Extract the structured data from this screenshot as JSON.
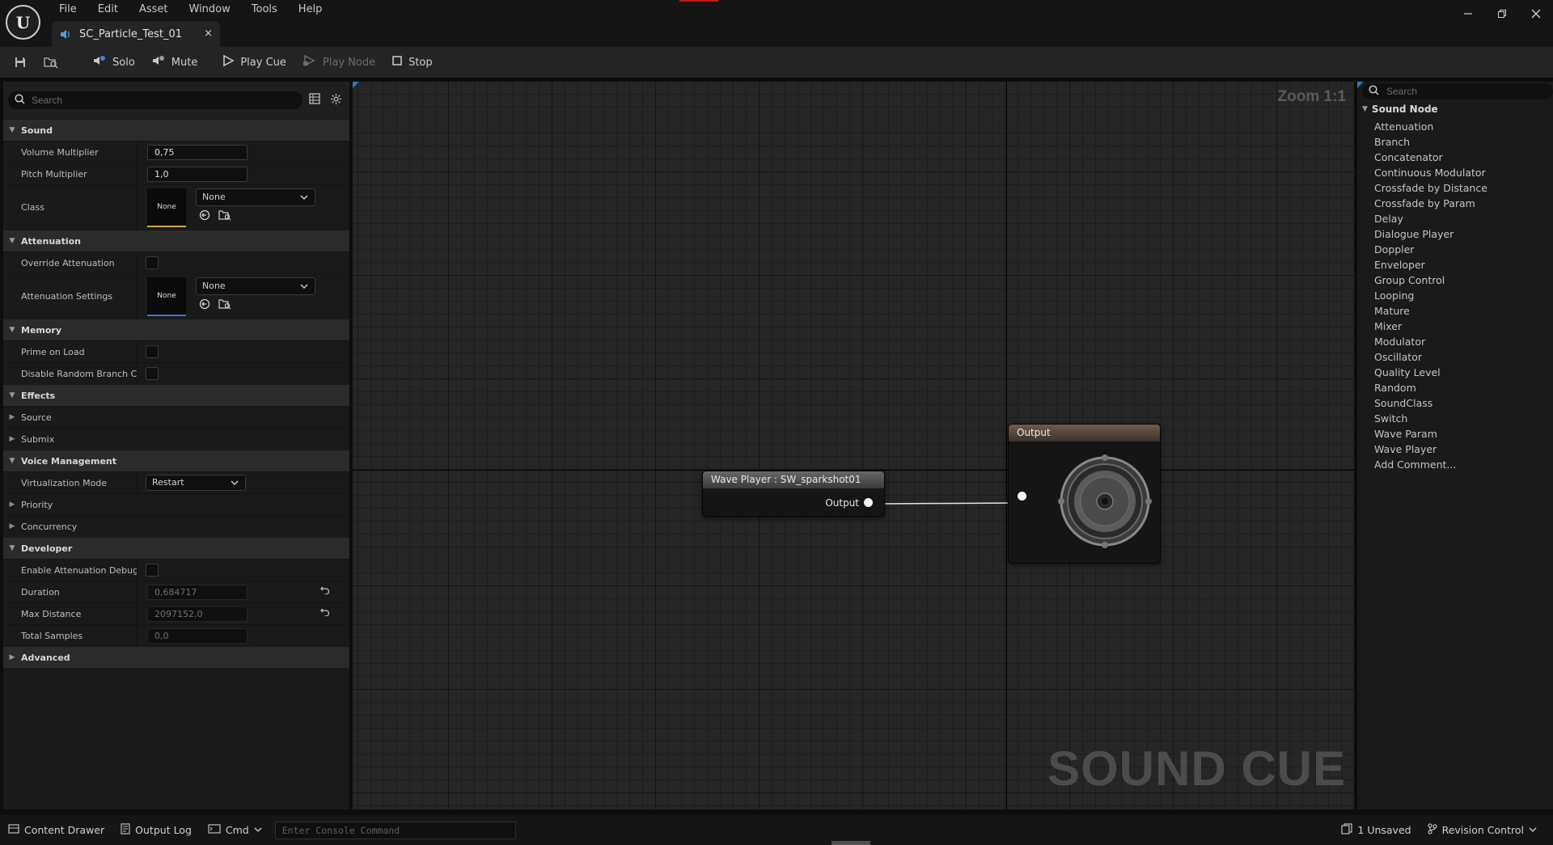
{
  "menubar": {
    "items": [
      "File",
      "Edit",
      "Asset",
      "Window",
      "Tools",
      "Help"
    ]
  },
  "tab": {
    "title": "SC_Particle_Test_01",
    "close": "×"
  },
  "toolbar": {
    "solo": "Solo",
    "mute": "Mute",
    "play_cue": "Play Cue",
    "play_node": "Play Node",
    "stop": "Stop"
  },
  "details": {
    "search_placeholder": "Search",
    "sound": {
      "label": "Sound",
      "volume_multiplier_label": "Volume Multiplier",
      "volume_multiplier": "0,75",
      "pitch_multiplier_label": "Pitch Multiplier",
      "pitch_multiplier": "1,0",
      "class_label": "Class",
      "class_thumb": "None",
      "class_value": "None"
    },
    "attenuation": {
      "label": "Attenuation",
      "override_label": "Override Attenuation",
      "settings_label": "Attenuation Settings",
      "settings_thumb": "None",
      "settings_value": "None"
    },
    "memory": {
      "label": "Memory",
      "prime_on_load_label": "Prime on Load",
      "disable_random_label": "Disable Random Branch C..."
    },
    "effects": {
      "label": "Effects",
      "source_label": "Source",
      "submix_label": "Submix"
    },
    "voice_management": {
      "label": "Voice Management",
      "virtualization_label": "Virtualization Mode",
      "virtualization_value": "Restart",
      "priority_label": "Priority",
      "concurrency_label": "Concurrency"
    },
    "developer": {
      "label": "Developer",
      "enable_debug_label": "Enable Attenuation Debug",
      "duration_label": "Duration",
      "duration": "0,684717",
      "max_distance_label": "Max Distance",
      "max_distance": "2097152,0",
      "total_samples_label": "Total Samples",
      "total_samples": "0,0"
    },
    "advanced": {
      "label": "Advanced"
    }
  },
  "graph": {
    "zoom": "Zoom 1:1",
    "watermark": "SOUND CUE",
    "wave_node": {
      "title": "Wave Player : SW_sparkshot01",
      "pin_label": "Output"
    },
    "output_node": {
      "title": "Output"
    }
  },
  "palette": {
    "search_placeholder": "Search",
    "root": "Sound Node",
    "items": [
      "Attenuation",
      "Branch",
      "Concatenator",
      "Continuous Modulator",
      "Crossfade by Distance",
      "Crossfade by Param",
      "Delay",
      "Dialogue Player",
      "Doppler",
      "Enveloper",
      "Group Control",
      "Looping",
      "Mature",
      "Mixer",
      "Modulator",
      "Oscillator",
      "Quality Level",
      "Random",
      "SoundClass",
      "Switch",
      "Wave Param",
      "Wave Player",
      "Add Comment..."
    ]
  },
  "statusbar": {
    "content_drawer": "Content Drawer",
    "output_log": "Output Log",
    "cmd": "Cmd",
    "console_placeholder": "Enter Console Command",
    "unsaved": "1 Unsaved",
    "revision_control": "Revision Control"
  },
  "colors": {
    "accent_blue": "#2b78c8",
    "class_underline": "#d4a54a",
    "attenuation_underline": "#4a6fd4",
    "recording_indicator": "#c01818"
  }
}
